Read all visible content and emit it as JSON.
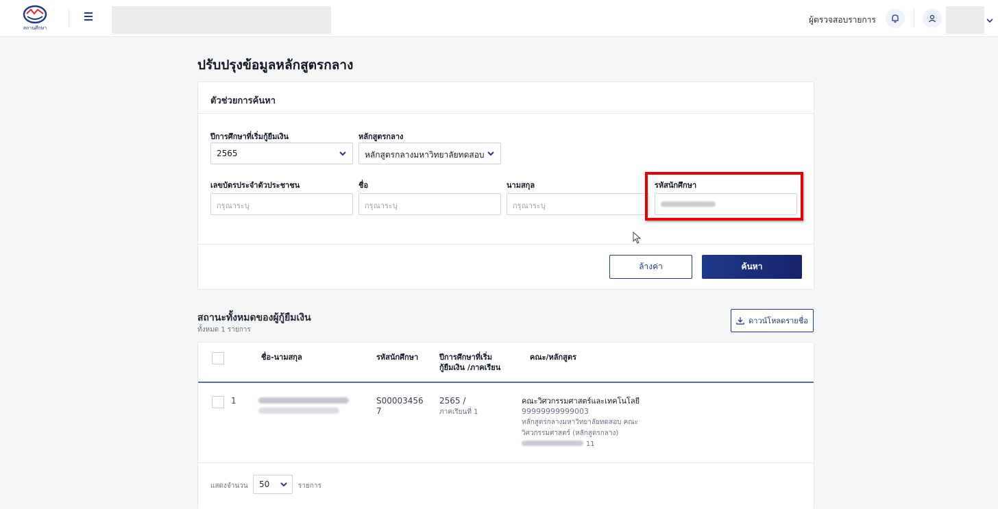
{
  "header": {
    "logo_text": "สถานศึกษา",
    "role_label": "ผู้ตรวจสอบรายการ"
  },
  "page": {
    "title": "ปรับปรุงข้อมูลหลักสูตรกลาง"
  },
  "search": {
    "card_title": "ตัวช่วยการค้นหา",
    "year_label": "ปีการศึกษาที่เริ่มกู้ยืมเงิน",
    "year_value": "2565",
    "curriculum_label": "หลักสูตรกลาง",
    "curriculum_value": "หลักสูตรกลางมหาวิทยาลัยทดสอบ",
    "id_card_label": "เลขบัตรประจำตัวประชาชน",
    "id_card_placeholder": "กรุณาระบุ",
    "first_name_label": "ชื่อ",
    "first_name_placeholder": "กรุณาระบุ",
    "last_name_label": "นามสกุล",
    "last_name_placeholder": "กรุณาระบุ",
    "student_id_label": "รหัสนักศึกษา",
    "clear_button": "ล้างค่า",
    "search_button": "ค้นหา"
  },
  "results": {
    "title": "สถานะทั้งหมดของผู้กู้ยืมเงิน",
    "subtitle": "ทั้งหมด 1 รายการ",
    "download_button": "ดาวน์โหลดรายชื่อ",
    "columns": {
      "name": "ชื่อ-นามสกุล",
      "student_id": "รหัสนักศึกษา",
      "year_term_1": "ปีการศึกษาที่เริ่ม",
      "year_term_2": "กู้ยืมเงิน /ภาคเรียน",
      "faculty": "คณะ/หลักสูตร"
    },
    "rows": [
      {
        "index": "1",
        "student_id_1": "S00003456",
        "student_id_2": "7",
        "year": "2565 /",
        "term": "ภาคเรียนที่ 1",
        "faculty": "คณะวิศวกรรมศาสตร์และเทคโนโลยี",
        "code": "99999999999003",
        "curriculum_1": "หลักสูตรกลางมหาวิทยาลัยทดสอบ คณะ",
        "curriculum_2": "วิศวกรรมศาสตร์ (หลักสูตรกลาง)",
        "code_suffix": "11"
      }
    ],
    "footer_show": "แสดงจำนวน",
    "page_size": "50",
    "footer_unit": "รายการ"
  }
}
